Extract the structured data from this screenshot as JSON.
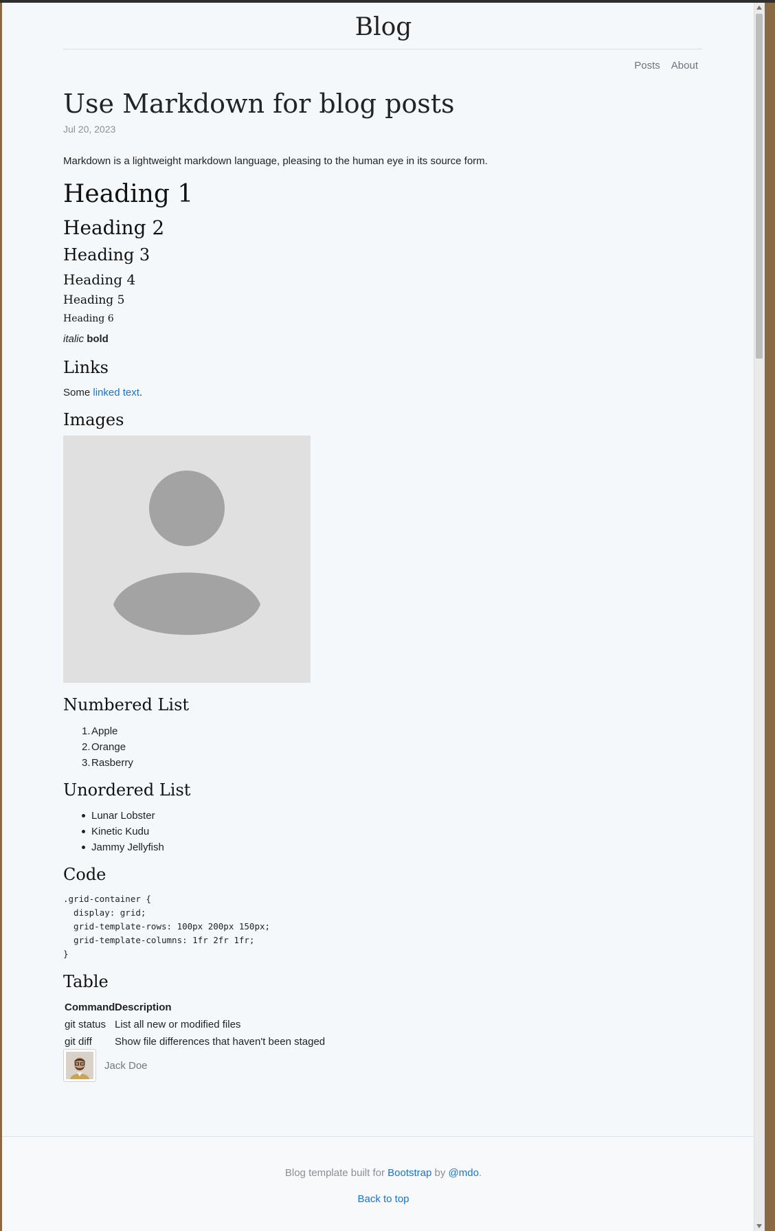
{
  "header": {
    "site_title": "Blog",
    "nav": [
      "Posts",
      "About"
    ]
  },
  "post": {
    "title": "Use Markdown for blog posts",
    "date": "Jul 20, 2023",
    "intro": "Markdown is a lightweight markdown language, pleasing to the human eye in its source form.",
    "headings": [
      "Heading 1",
      "Heading 2",
      "Heading 3",
      "Heading 4",
      "Heading 5",
      "Heading 6"
    ],
    "italic_text": "italic",
    "bold_text": "bold",
    "links_heading": "Links",
    "link_prefix": "Some ",
    "link_text": "linked text",
    "link_suffix": ".",
    "images_heading": "Images",
    "numbered_heading": "Numbered List",
    "numbered_items": [
      "Apple",
      "Orange",
      "Rasberry"
    ],
    "unordered_heading": "Unordered List",
    "unordered_items": [
      "Lunar Lobster",
      "Kinetic Kudu",
      "Jammy Jellyfish"
    ],
    "code_heading": "Code",
    "code_block": ".grid-container {\n  display: grid;\n  grid-template-rows: 100px 200px 150px;\n  grid-template-columns: 1fr 2fr 1fr;\n}",
    "table_heading": "Table",
    "table": {
      "headers": [
        "Command",
        "Description"
      ],
      "rows": [
        [
          "git status",
          "List all new or modified files"
        ],
        [
          "git diff",
          "Show file differences that haven't been staged"
        ]
      ]
    },
    "author": "Jack Doe"
  },
  "footer": {
    "prefix": "Blog template built for ",
    "bootstrap_link": "Bootstrap",
    "by": " by ",
    "mdo_link": "@mdo",
    "suffix": ".",
    "back_to_top": "Back to top"
  },
  "colors": {
    "link": "#1a73c8",
    "page_bg": "#f4f8fb"
  }
}
